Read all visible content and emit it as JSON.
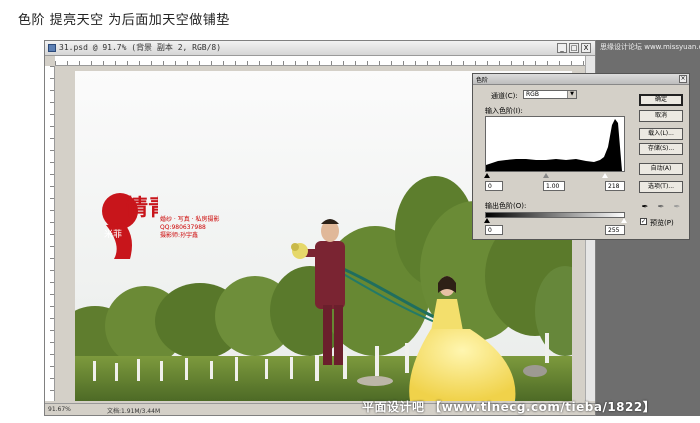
{
  "caption": "色阶 提亮天空 为后面加天空做铺垫",
  "ps_window": {
    "title": "31.psd @ 91.7% (背景 副本 2, RGB/8)",
    "buttons": [
      "_",
      "□",
      "X"
    ],
    "status_zoom": "91.67%",
    "status_doc": "文档:1.91M/3.44M"
  },
  "top_watermark": "思缘设计论坛 www.missyuan.com",
  "logo": {
    "big_chars": "情青",
    "small_chars": "米菲",
    "studio_lines": [
      "婚纱 · 写真 · 私房摄影",
      "QQ:980637988",
      "摄影师:孙宇鑫"
    ],
    "colors": {
      "logo_red": "#c8151b"
    }
  },
  "footer_watermark": "平面设计吧 【www.tlnecg.com/tieba/1822】",
  "levels_dialog": {
    "title": "色阶",
    "channel_label": "通道(C):",
    "channel_value": "RGB",
    "input_label": "输入色阶(I):",
    "input_black": "0",
    "input_gamma": "1.00",
    "input_white": "218",
    "output_label": "输出色阶(O):",
    "output_black": "0",
    "output_white": "255",
    "buttons": {
      "ok": "确定",
      "cancel": "取消",
      "load": "载入(L)...",
      "save": "存储(S)...",
      "auto": "自动(A)",
      "options": "选项(T)..."
    },
    "preview_label": "预览(P)",
    "preview_checked": "✓",
    "close": "×"
  }
}
